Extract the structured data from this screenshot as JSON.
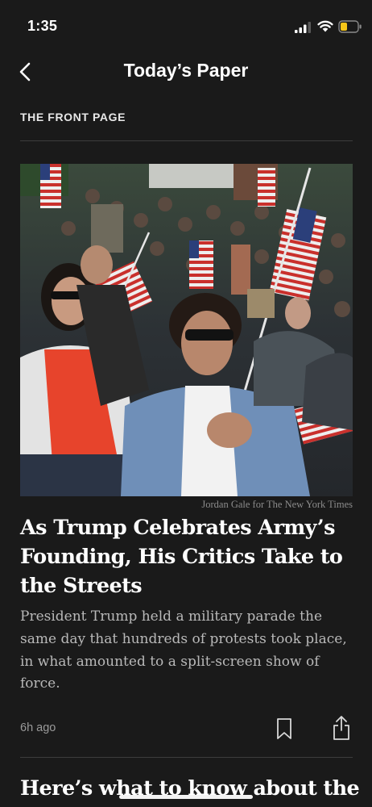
{
  "status_bar": {
    "time": "1:35"
  },
  "nav": {
    "back_icon": "chevron-left-icon",
    "title": "Today’s Paper"
  },
  "section": {
    "label": "THE FRONT PAGE"
  },
  "article": {
    "photo_credit": "Jordan Gale for The New York Times",
    "headline": "As Trump Celebrates Army’s Founding, His Critics Take to the Streets",
    "summary": "President Trump held a military parade the same day that hundreds of protests took place, in what amounted to a split-screen show of force.",
    "timestamp": "6h ago",
    "bookmark_icon": "bookmark-icon",
    "share_icon": "share-icon"
  },
  "next_article": {
    "headline": "Here’s what to know about the"
  },
  "colors": {
    "background": "#1a1a1a",
    "battery_level": "#f5c518"
  }
}
